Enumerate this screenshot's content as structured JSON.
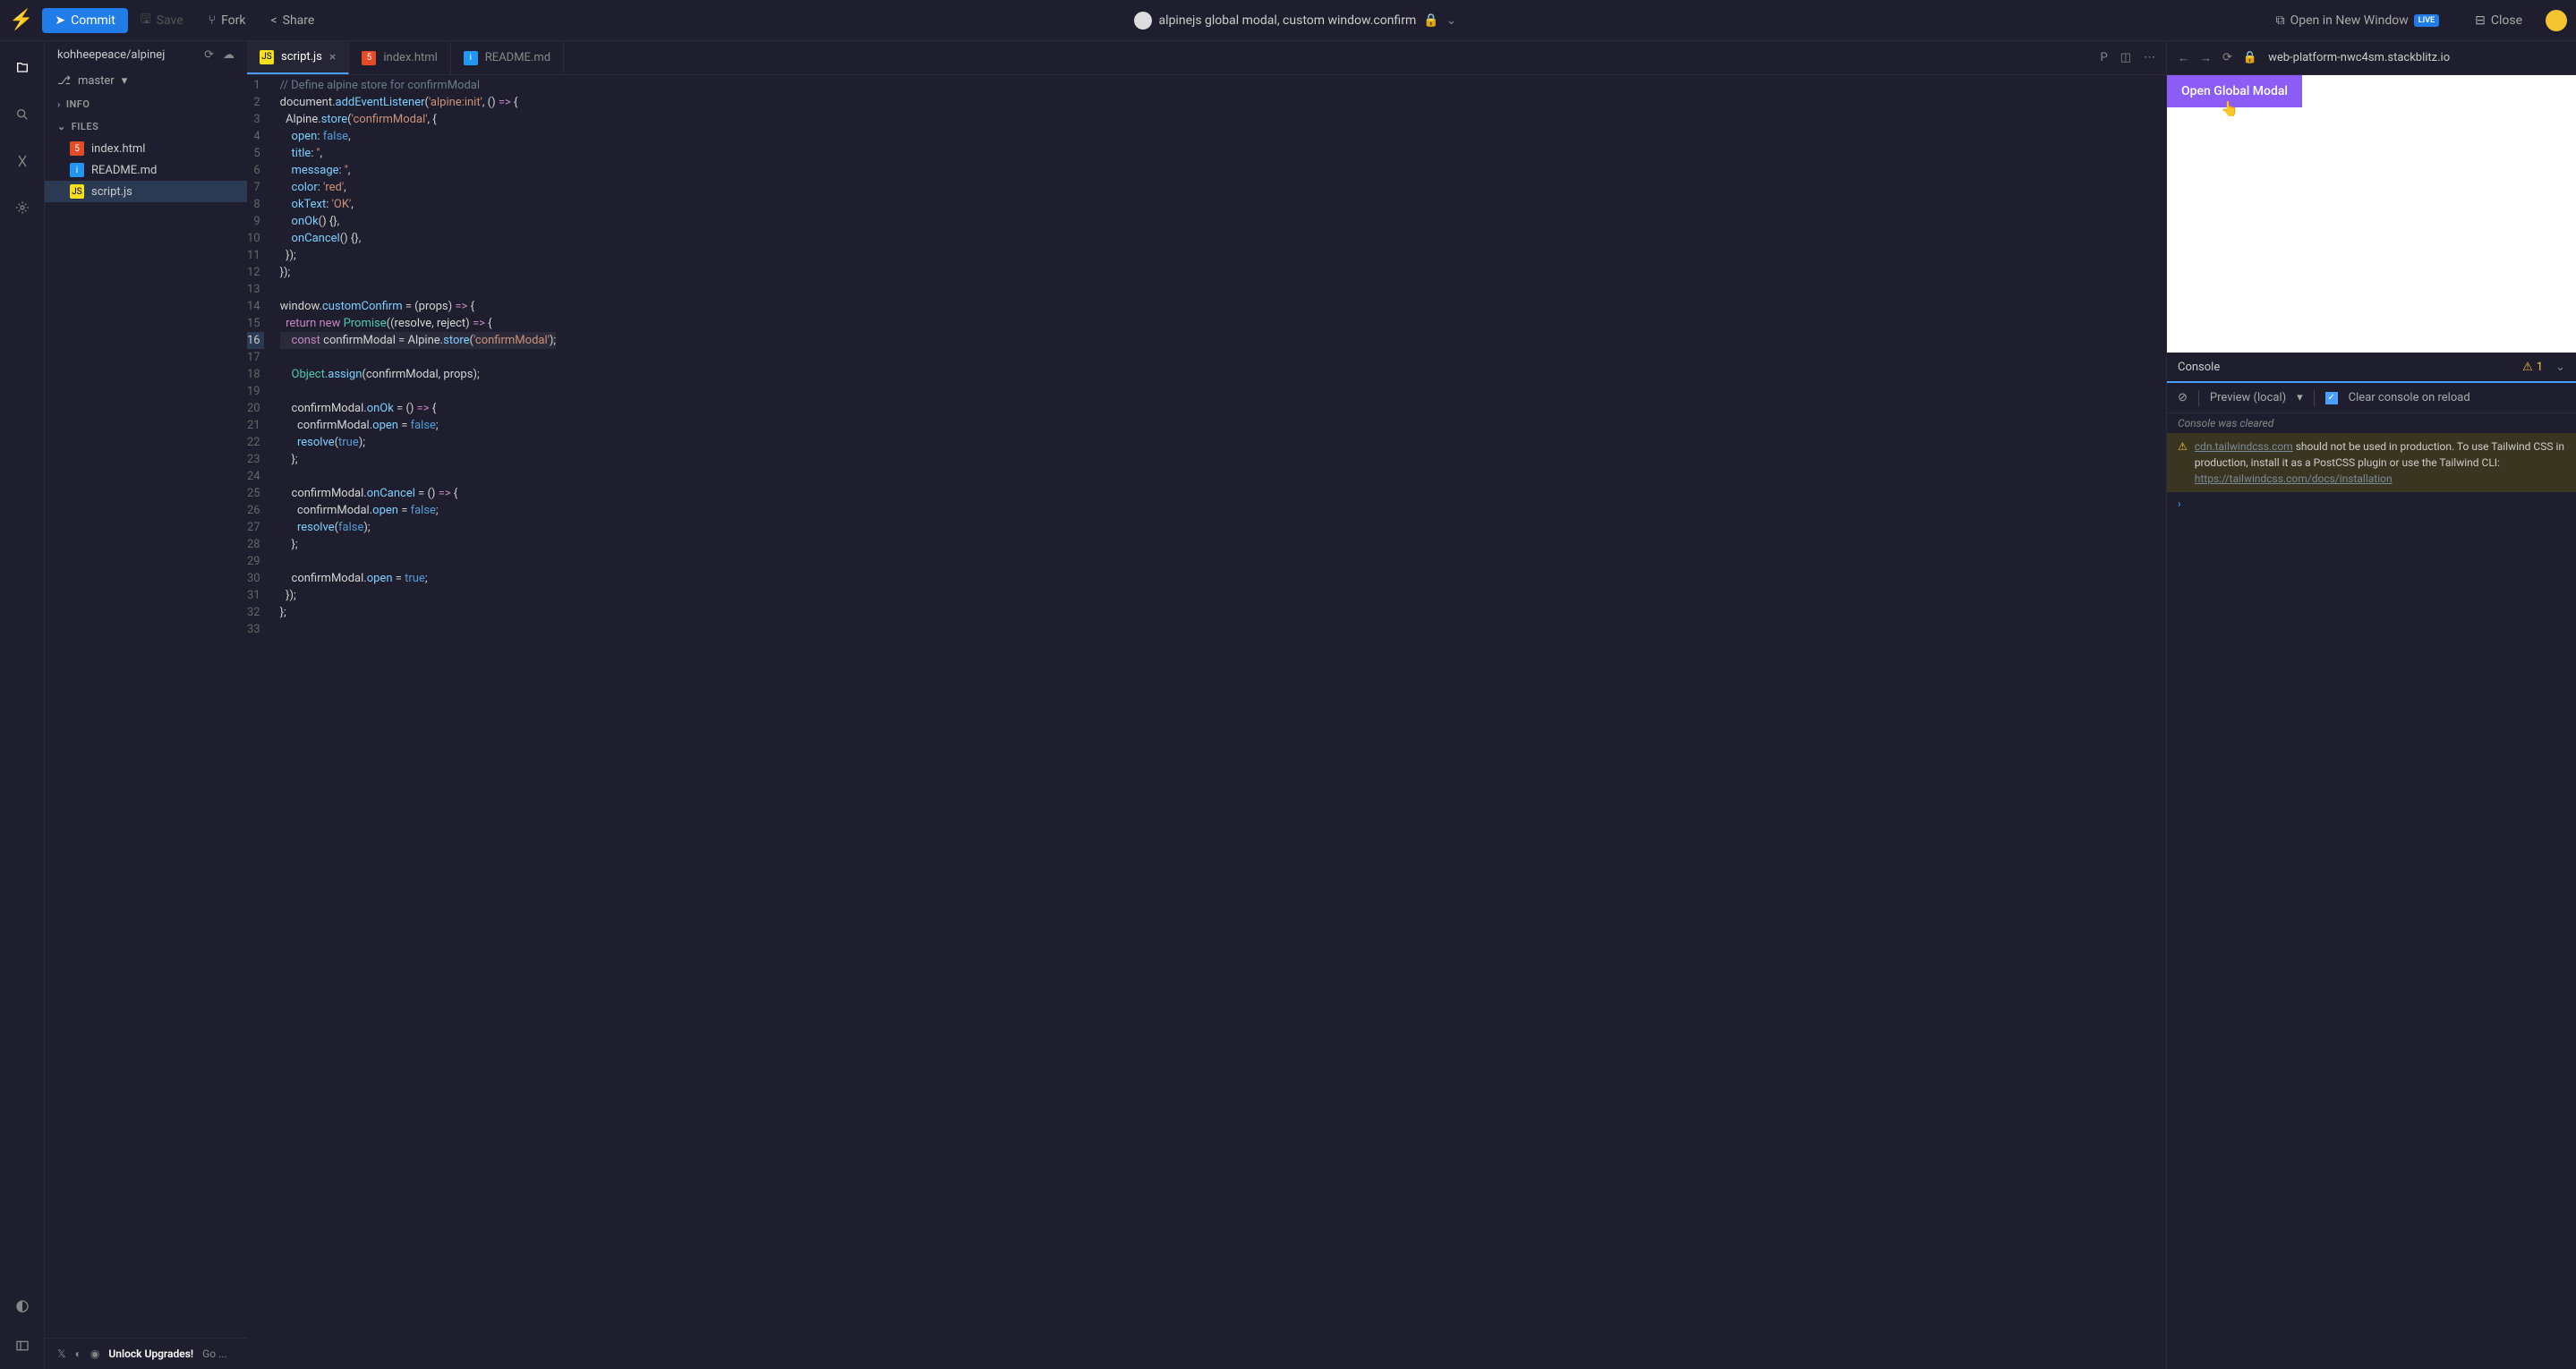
{
  "topbar": {
    "commit": "Commit",
    "save": "Save",
    "fork": "Fork",
    "share": "Share",
    "title": "alpinejs global modal, custom window.confirm",
    "open_new_window": "Open in New Window",
    "live": "LIVE",
    "close": "Close"
  },
  "sidebar": {
    "repo": "kohheepeace/alpinej",
    "branch": "master",
    "info_header": "INFO",
    "files_header": "FILES",
    "files": [
      {
        "name": "index.html",
        "type": "html"
      },
      {
        "name": "README.md",
        "type": "md"
      },
      {
        "name": "script.js",
        "type": "js",
        "active": true
      }
    ],
    "unlock": "Unlock Upgrades!",
    "unlock_go": "Go ..."
  },
  "tabs": [
    {
      "name": "script.js",
      "type": "js",
      "active": true
    },
    {
      "name": "index.html",
      "type": "html"
    },
    {
      "name": "README.md",
      "type": "md"
    }
  ],
  "code_lines": [
    {
      "n": 1,
      "html": "<span class='c-comment'>// Define alpine store for confirmModal</span>"
    },
    {
      "n": 2,
      "html": "<span class='c-ident'>document</span>.<span class='c-func'>addEventListener</span>(<span class='c-str'>'alpine:init'</span>, () <span class='c-kw'>=&gt;</span> {"
    },
    {
      "n": 3,
      "html": "  <span class='c-ident'>Alpine</span>.<span class='c-func'>store</span>(<span class='c-str'>'confirmModal'</span>, {"
    },
    {
      "n": 4,
      "html": "    <span class='c-prop'>open</span>: <span class='c-const'>false</span>,"
    },
    {
      "n": 5,
      "html": "    <span class='c-prop'>title</span>: <span class='c-str'>''</span>,"
    },
    {
      "n": 6,
      "html": "    <span class='c-prop'>message</span>: <span class='c-str'>''</span>,"
    },
    {
      "n": 7,
      "html": "    <span class='c-prop'>color</span>: <span class='c-str'>'red'</span>,"
    },
    {
      "n": 8,
      "html": "    <span class='c-prop'>okText</span>: <span class='c-str'>'OK'</span>,"
    },
    {
      "n": 9,
      "html": "    <span class='c-func'>onOk</span>() {},"
    },
    {
      "n": 10,
      "html": "    <span class='c-func'>onCancel</span>() {},"
    },
    {
      "n": 11,
      "html": "  });"
    },
    {
      "n": 12,
      "html": "});"
    },
    {
      "n": 13,
      "html": ""
    },
    {
      "n": 14,
      "html": "<span class='c-ident'>window</span>.<span class='c-func'>customConfirm</span> = (<span class='c-ident'>props</span>) <span class='c-kw'>=&gt;</span> {"
    },
    {
      "n": 15,
      "html": "  <span class='c-kw'>return</span> <span class='c-new'>new</span> <span class='c-type'>Promise</span>((<span class='c-ident'>resolve</span>, <span class='c-ident'>reject</span>) <span class='c-kw'>=&gt;</span> {"
    },
    {
      "n": 16,
      "hl": true,
      "html": "    <span class='c-kw'>const</span> <span class='c-ident'>confirmModal</span> = <span class='c-ident'>Alpine</span>.<span class='c-func'>store</span>(<span class='c-str'>'confirmModal'</span>);"
    },
    {
      "n": 17,
      "html": ""
    },
    {
      "n": 18,
      "html": "    <span class='c-type'>Object</span>.<span class='c-func'>assign</span>(<span class='c-ident'>confirmModal</span>, <span class='c-ident'>props</span>);"
    },
    {
      "n": 19,
      "html": ""
    },
    {
      "n": 20,
      "html": "    <span class='c-ident'>confirmModal</span>.<span class='c-func'>onOk</span> = () <span class='c-kw'>=&gt;</span> {"
    },
    {
      "n": 21,
      "html": "      <span class='c-ident'>confirmModal</span>.<span class='c-prop'>open</span> = <span class='c-const'>false</span>;"
    },
    {
      "n": 22,
      "html": "      <span class='c-func'>resolve</span>(<span class='c-const'>true</span>);"
    },
    {
      "n": 23,
      "html": "    };"
    },
    {
      "n": 24,
      "html": ""
    },
    {
      "n": 25,
      "html": "    <span class='c-ident'>confirmModal</span>.<span class='c-func'>onCancel</span> = () <span class='c-kw'>=&gt;</span> {"
    },
    {
      "n": 26,
      "html": "      <span class='c-ident'>confirmModal</span>.<span class='c-prop'>open</span> = <span class='c-const'>false</span>;"
    },
    {
      "n": 27,
      "html": "      <span class='c-func'>resolve</span>(<span class='c-const'>false</span>);"
    },
    {
      "n": 28,
      "html": "    };"
    },
    {
      "n": 29,
      "html": ""
    },
    {
      "n": 30,
      "html": "    <span class='c-ident'>confirmModal</span>.<span class='c-prop'>open</span> = <span class='c-const'>true</span>;"
    },
    {
      "n": 31,
      "html": "  });"
    },
    {
      "n": 32,
      "html": "};"
    },
    {
      "n": 33,
      "html": ""
    }
  ],
  "preview": {
    "url": "web-platform-nwc4sm.stackblitz.io",
    "button": "Open Global Modal"
  },
  "console": {
    "title": "Console",
    "warn_count": "1",
    "source": "Preview (local)",
    "clear_label": "Clear console on reload",
    "cleared": "Console was cleared",
    "warn_link1": "cdn.tailwindcss.com",
    "warn_text": " should not be used in production. To use Tailwind CSS in production, install it as a PostCSS plugin or use the Tailwind CLI: ",
    "warn_link2": "https://tailwindcss.com/docs/installation"
  }
}
